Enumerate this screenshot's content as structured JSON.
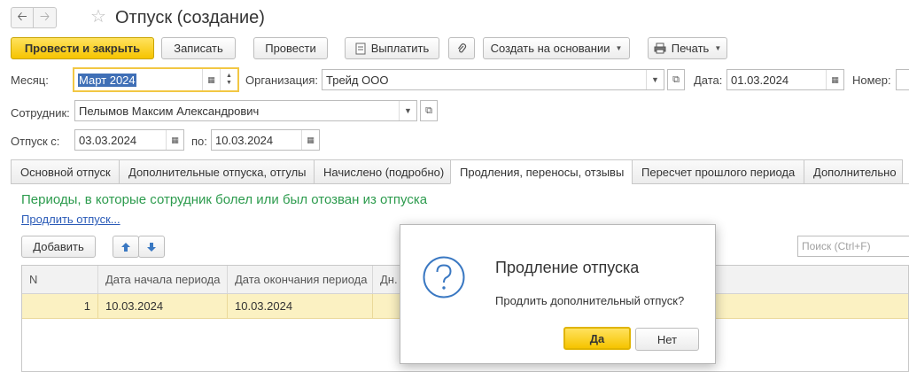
{
  "window": {
    "title": "Отпуск (создание)"
  },
  "toolbar": {
    "post_and_close": "Провести и закрыть",
    "save": "Записать",
    "post": "Провести",
    "pay": "Выплатить",
    "create_based_on": "Создать на основании",
    "print": "Печать"
  },
  "form": {
    "month_label": "Месяц:",
    "month_value": "Март 2024",
    "org_label": "Организация:",
    "org_value": "Трейд ООО",
    "date_label": "Дата:",
    "date_value": "01.03.2024",
    "number_label": "Номер:",
    "employee_label": "Сотрудник:",
    "employee_value": "Пелымов Максим Александрович",
    "from_label": "Отпуск с:",
    "from_value": "03.03.2024",
    "to_label": "по:",
    "to_value": "10.03.2024"
  },
  "tabs": [
    {
      "label": "Основной отпуск"
    },
    {
      "label": "Дополнительные отпуска, отгулы"
    },
    {
      "label": "Начислено (подробно)"
    },
    {
      "label": "Продления, переносы, отзывы"
    },
    {
      "label": "Пересчет прошлого периода"
    },
    {
      "label": "Дополнительно"
    }
  ],
  "panel": {
    "heading": "Периоды, в которые сотрудник болел или был отозван из отпуска",
    "extend_link": "Продлить отпуск...",
    "add_button": "Добавить",
    "search_placeholder": "Поиск (Ctrl+F)"
  },
  "table": {
    "columns": [
      "N",
      "Дата начала периода",
      "Дата окончания периода",
      "Дн."
    ],
    "rows": [
      {
        "n": "1",
        "start": "10.03.2024",
        "end": "10.03.2024"
      }
    ]
  },
  "dialog": {
    "title": "Продление отпуска",
    "message": "Продлить дополнительный отпуск?",
    "yes": "Да",
    "no": "Нет"
  },
  "colors": {
    "accent_yellow": "#f6c400",
    "selected_row": "#fbf1c2",
    "heading_green": "#2c9b4d",
    "link_blue": "#2a5bb8",
    "question_icon": "#3a78c2"
  }
}
